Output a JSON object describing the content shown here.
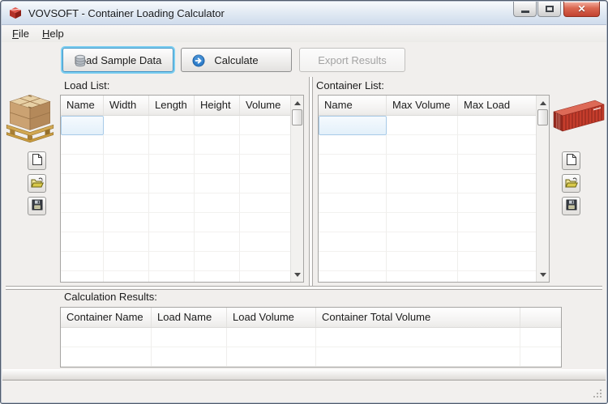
{
  "window": {
    "title": "VOVSOFT - Container Loading Calculator"
  },
  "menu": {
    "items": [
      {
        "label": "File"
      },
      {
        "label": "Help"
      }
    ]
  },
  "toolbar": {
    "load_sample_label": "Load Sample Data",
    "calculate_label": "Calculate",
    "export_label": "Export Results"
  },
  "load_list": {
    "label": "Load List:",
    "columns": [
      "Name",
      "Width",
      "Length",
      "Height",
      "Volume"
    ]
  },
  "container_list": {
    "label": "Container List:",
    "columns": [
      "Name",
      "Max Volume",
      "Max Load"
    ]
  },
  "results": {
    "label": "Calculation Results:",
    "columns": [
      "Container Name",
      "Load Name",
      "Load Volume",
      "Container Total Volume",
      ""
    ]
  },
  "icons": {
    "app": "red-cube-logo",
    "load_sample": "database-icon",
    "calculate": "blue-arrow-circle-icon",
    "new": "new-file-icon",
    "open": "open-folder-icon",
    "save": "save-floppy-icon",
    "pallet": "pallet-with-boxes-image",
    "container": "red-shipping-container-image"
  },
  "colors": {
    "titlebar_top": "#f7fafc",
    "titlebar_bottom": "#cfdcec",
    "close_button_red": "#c14230",
    "accent_blue": "#2f7ecb",
    "focus_ring": "#7bcdf0",
    "client_bg": "#f1efed",
    "container_red": "#c53d2c",
    "selection_blue": "#e3f0fa"
  }
}
